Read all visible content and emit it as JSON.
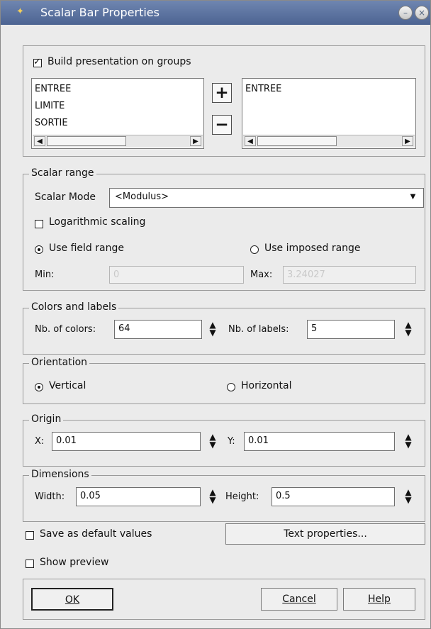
{
  "window": {
    "title": "Scalar Bar Properties",
    "buttons": [
      "minimize-icon",
      "close-icon"
    ]
  },
  "groups_section": {
    "checkbox_label": "Build presentation on groups",
    "available_groups": [
      "ENTREE",
      "LIMITE",
      "SORTIE"
    ],
    "selected_groups": [
      "ENTREE"
    ],
    "add_icon": "plus-icon",
    "remove_icon": "minus-icon"
  },
  "scalar_range": {
    "title": "Scalar range",
    "mode_label": "Scalar Mode",
    "mode_value": "<Modulus>",
    "log_label": "Logarithmic scaling",
    "field_range_label": "Use field range",
    "imposed_range_label": "Use imposed range",
    "min_label": "Min:",
    "min_value": "0",
    "max_label": "Max:",
    "max_value": "3.24027"
  },
  "colors_labels": {
    "title": "Colors and labels",
    "colors_label": "Nb. of colors:",
    "colors_value": "64",
    "labels_label": "Nb. of labels:",
    "labels_value": "5"
  },
  "orientation": {
    "title": "Orientation",
    "vertical_label": "Vertical",
    "horizontal_label": "Horizontal"
  },
  "origin": {
    "title": "Origin",
    "x_label": "X:",
    "x_value": "0.01",
    "y_label": "Y:",
    "y_value": "0.01"
  },
  "dimensions": {
    "title": "Dimensions",
    "width_label": "Width:",
    "width_value": "0.05",
    "height_label": "Height:",
    "height_value": "0.5"
  },
  "bottom": {
    "save_default_label": "Save as default values",
    "text_properties_label": "Text properties...",
    "show_preview_label": "Show preview",
    "ok_label": "OK",
    "cancel_label": "Cancel",
    "help_label": "Help"
  }
}
